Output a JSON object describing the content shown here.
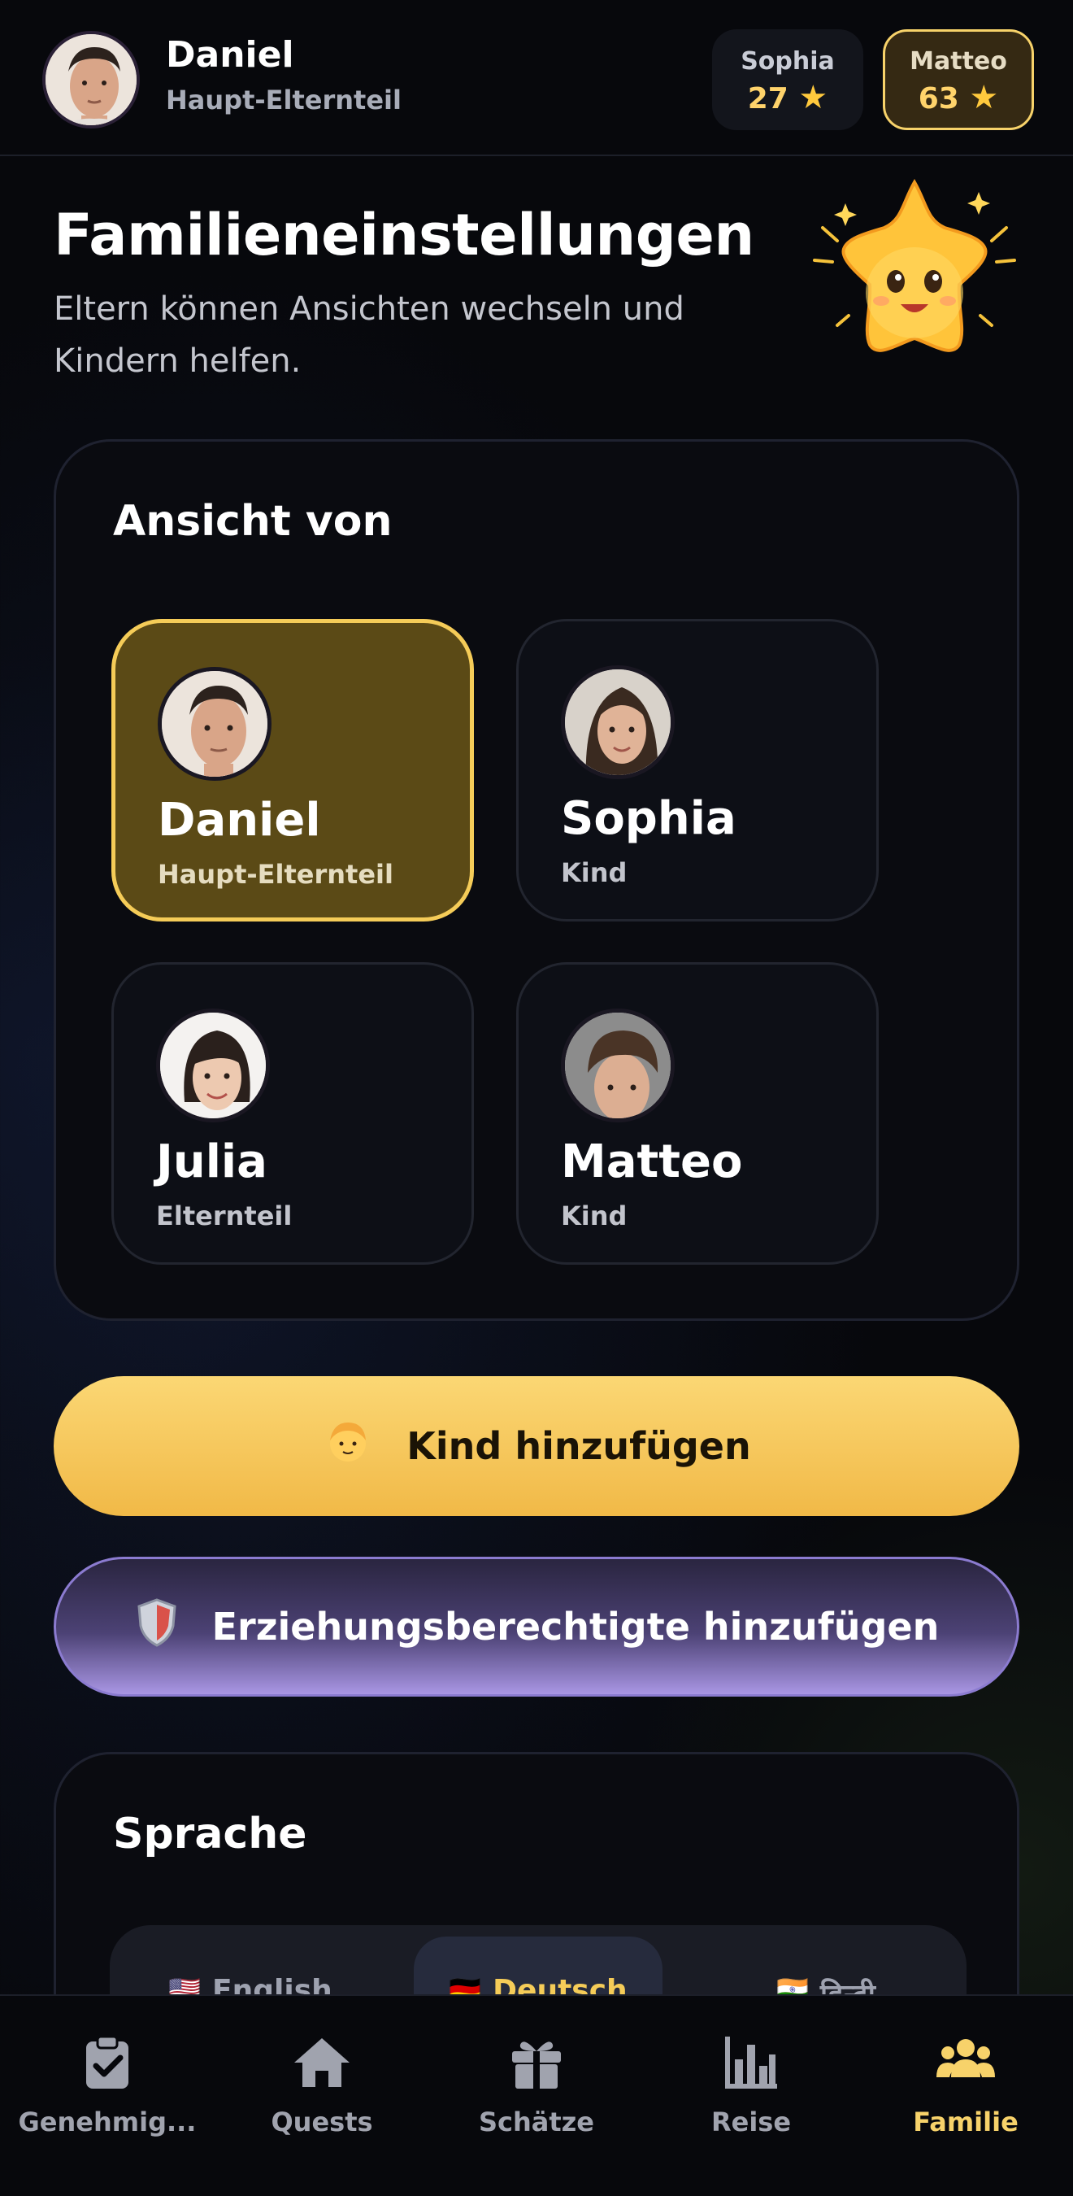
{
  "header": {
    "user_name": "Daniel",
    "user_role": "Haupt-Elternteil",
    "chips": [
      {
        "name": "Sophia",
        "stars": "27"
      },
      {
        "name": "Matteo",
        "stars": "63"
      }
    ]
  },
  "page": {
    "title": "Familieneinstellungen",
    "subtitle": "Eltern können Ansichten wechseln und Kindern helfen."
  },
  "view_as": {
    "title": "Ansicht von",
    "members": [
      {
        "name": "Daniel",
        "role": "Haupt-Elternteil",
        "selected": true
      },
      {
        "name": "Sophia",
        "role": "Kind",
        "selected": false
      },
      {
        "name": "Julia",
        "role": "Elternteil",
        "selected": false
      },
      {
        "name": "Matteo",
        "role": "Kind",
        "selected": false
      }
    ]
  },
  "actions": {
    "add_child": "Kind hinzufügen",
    "add_guardian": "Erziehungsberechtigte hinzufügen"
  },
  "language": {
    "title": "Sprache",
    "options": [
      {
        "label": "English",
        "flag": "🇺🇸",
        "active": false
      },
      {
        "label": "Deutsch",
        "flag": "🇩🇪",
        "active": true
      },
      {
        "label": "हिन्दी",
        "flag": "🇮🇳",
        "active": false
      }
    ]
  },
  "nav": {
    "items": [
      {
        "label": "Genehmig...",
        "icon": "clipboard-check-icon",
        "active": false
      },
      {
        "label": "Quests",
        "icon": "home-icon",
        "active": false
      },
      {
        "label": "Schätze",
        "icon": "gift-icon",
        "active": false
      },
      {
        "label": "Reise",
        "icon": "bar-chart-icon",
        "active": false
      },
      {
        "label": "Familie",
        "icon": "family-icon",
        "active": true
      }
    ]
  },
  "colors": {
    "accent": "#f5cc58",
    "selected_tile": "#5b4a16",
    "guardian_button": "#a996e4"
  }
}
